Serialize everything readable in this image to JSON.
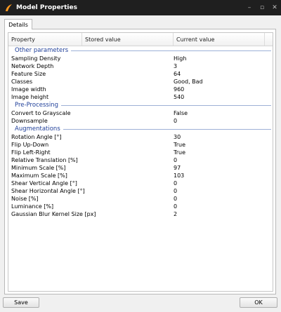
{
  "window": {
    "title": "Model Properties",
    "minimize_glyph": "–",
    "maximize_glyph": "▫",
    "close_glyph": "✕",
    "icon": "app-swirl-icon",
    "accent": "#ff9a1f"
  },
  "tabs": [
    {
      "label": "Details"
    }
  ],
  "table": {
    "columns": [
      "Property",
      "Stored value",
      "Current value"
    ],
    "groups": [
      {
        "label": "Other parameters",
        "rows": [
          {
            "property": "Sampling Density",
            "stored": "",
            "current": "High"
          },
          {
            "property": "Network Depth",
            "stored": "",
            "current": "3"
          },
          {
            "property": "Feature Size",
            "stored": "",
            "current": "64"
          },
          {
            "property": "Classes",
            "stored": "",
            "current": "Good, Bad"
          },
          {
            "property": "Image width",
            "stored": "",
            "current": "960"
          },
          {
            "property": "Image height",
            "stored": "",
            "current": "540"
          }
        ]
      },
      {
        "label": "Pre-Processing",
        "rows": [
          {
            "property": "Convert to Grayscale",
            "stored": "",
            "current": "False"
          },
          {
            "property": "Downsample",
            "stored": "",
            "current": "0"
          }
        ]
      },
      {
        "label": "Augmentations",
        "rows": [
          {
            "property": "Rotation Angle [°]",
            "stored": "",
            "current": "30"
          },
          {
            "property": "Flip Up-Down",
            "stored": "",
            "current": "True"
          },
          {
            "property": "Flip Left-Right",
            "stored": "",
            "current": "True"
          },
          {
            "property": "Relative Translation [%]",
            "stored": "",
            "current": "0"
          },
          {
            "property": "Minimum Scale [%]",
            "stored": "",
            "current": "97"
          },
          {
            "property": "Maximum Scale [%]",
            "stored": "",
            "current": "103"
          },
          {
            "property": "Shear Vertical Angle [°]",
            "stored": "",
            "current": "0"
          },
          {
            "property": "Shear Horizontal Angle [°]",
            "stored": "",
            "current": "0"
          },
          {
            "property": "Noise [%]",
            "stored": "",
            "current": "0"
          },
          {
            "property": "Luminance [%]",
            "stored": "",
            "current": "0"
          },
          {
            "property": "Gaussian Blur Kernel Size [px]",
            "stored": "",
            "current": "2"
          }
        ]
      }
    ]
  },
  "buttons": {
    "save": "Save",
    "ok": "OK"
  }
}
